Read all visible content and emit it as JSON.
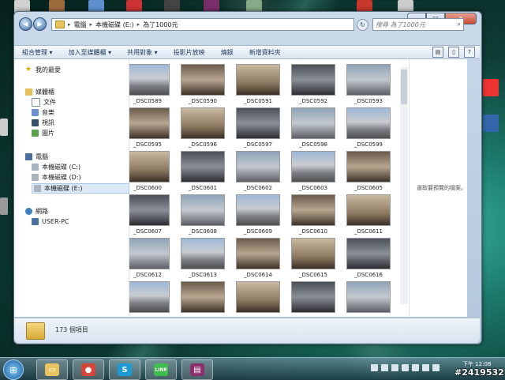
{
  "window": {
    "controls": {
      "minimize": "–",
      "maximize": "□",
      "close": "✕"
    }
  },
  "address": {
    "crumbs": [
      "電腦",
      "本機磁碟 (E:)",
      "為了1000元"
    ],
    "search_placeholder": "搜尋 為了1000元"
  },
  "toolbar": {
    "items": [
      "組合管理 ▾",
      "加入至媒體櫃 ▾",
      "共用對象 ▾",
      "投影片放映",
      "燒錄",
      "新增資料夾"
    ]
  },
  "navpane": {
    "favorites": "我的最愛",
    "libraries": "媒體櫃",
    "library_items": [
      "文件",
      "音樂",
      "視訊",
      "圖片"
    ],
    "computer": "電腦",
    "drives": [
      "本機磁碟 (C:)",
      "本機磁碟 (D:)",
      "本機磁碟 (E:)"
    ],
    "network": "網路",
    "network_items": [
      "USER-PC"
    ]
  },
  "files": [
    "_DSC0589",
    "_DSC0590",
    "_DSC0591",
    "_DSC0592",
    "_DSC0593",
    "_DSC0595",
    "_DSC0596",
    "_DSC0597",
    "_DSC0598",
    "_DSC0599",
    "_DSC0600",
    "_DSC0601",
    "_DSC0602",
    "_DSC0603",
    "_DSC0605",
    "_DSC0607",
    "_DSC0608",
    "_DSC0609",
    "_DSC0610",
    "_DSC0611",
    "_DSC0612",
    "_DSC0613",
    "_DSC0614",
    "_DSC0615",
    "_DSC0616"
  ],
  "preview": {
    "text": "選取要預覽的檔案。"
  },
  "status": {
    "count_text": "173 個項目"
  },
  "taskbar": {
    "start_glyph": "⊞",
    "apps": [
      {
        "name": "explorer",
        "glyph": "▭",
        "color": "#e8c35e"
      },
      {
        "name": "chrome",
        "glyph": "●",
        "color": "#d9443a"
      },
      {
        "name": "skype",
        "glyph": "S",
        "color": "#1a9bd7"
      },
      {
        "name": "line",
        "glyph": "LINE",
        "color": "#3ebd4b"
      },
      {
        "name": "winrar",
        "glyph": "▤",
        "color": "#8a2f6c"
      }
    ],
    "clock_line1": "下午 12:08"
  },
  "watermark": "#2419532"
}
